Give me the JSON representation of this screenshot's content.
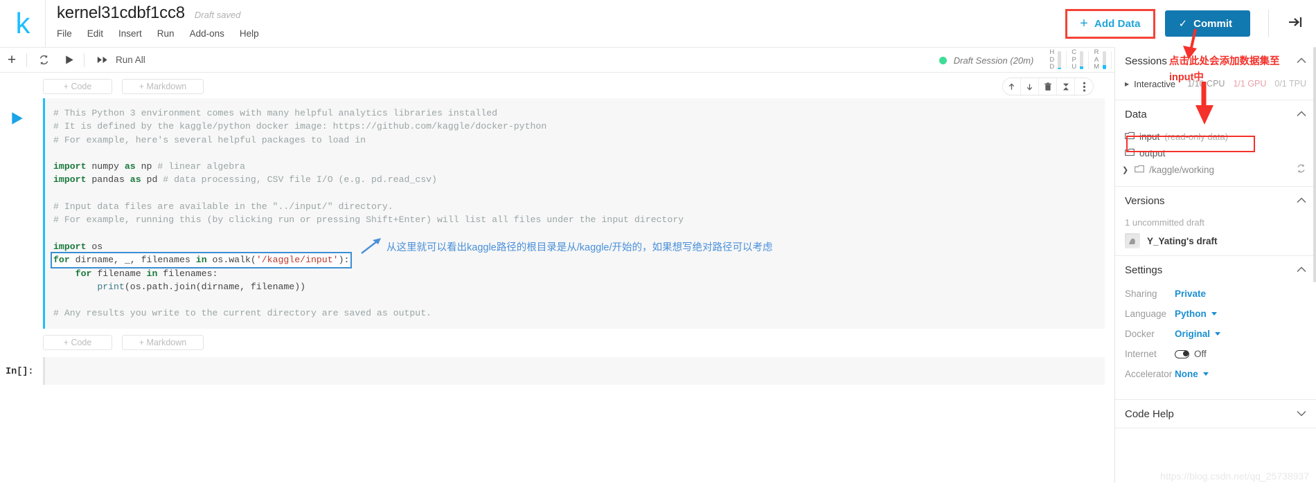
{
  "app": {
    "logo": "k",
    "logo_color": "#20beff",
    "accent_blue": "#20beff",
    "commit_blue": "#1278b0",
    "annotation_red": "#f4312a",
    "annotation_blue": "#4a90d9"
  },
  "header": {
    "kernel_title": "kernel31cdbf1cc8",
    "save_status": "Draft saved",
    "menu": [
      {
        "label": "File",
        "name": "menu-file"
      },
      {
        "label": "Edit",
        "name": "menu-edit"
      },
      {
        "label": "Insert",
        "name": "menu-insert"
      },
      {
        "label": "Run",
        "name": "menu-run"
      },
      {
        "label": "Add-ons",
        "name": "menu-addons"
      },
      {
        "label": "Help",
        "name": "menu-help"
      }
    ],
    "add_data_label": "Add Data",
    "add_data_plus": "+",
    "commit_label": "Commit",
    "commit_check": "✓",
    "collapse_icon": "collapse-sidebar-icon"
  },
  "toolbar": {
    "add_cell_icon": "+",
    "restart_icon": "restart-icon",
    "run_icon": "run-icon",
    "run_all_label": "Run All",
    "session_status": "Draft Session (20m)",
    "session_dot_color": "#3ddc97",
    "gauges": [
      {
        "label": "HDD",
        "letters": [
          "H",
          "D",
          "D"
        ],
        "fill_pct": 8
      },
      {
        "label": "CPU",
        "letters": [
          "C",
          "P",
          "U"
        ],
        "fill_pct": 15
      },
      {
        "label": "RAM",
        "letters": [
          "R",
          "A",
          "M"
        ],
        "fill_pct": 22
      }
    ]
  },
  "cells": {
    "add_code_label": "+ Code",
    "add_markdown_label": "+ Markdown",
    "cell_icons": [
      {
        "name": "move-cell-up-icon",
        "glyph": "↑"
      },
      {
        "name": "move-cell-down-icon",
        "glyph": "↓"
      },
      {
        "name": "delete-cell-icon",
        "glyph": "trash"
      },
      {
        "name": "collapse-cell-icon",
        "glyph": "collapse"
      },
      {
        "name": "cell-more-options-icon",
        "glyph": "⋮"
      }
    ],
    "code_lines": [
      {
        "type": "comment",
        "text": "# This Python 3 environment comes with many helpful analytics libraries installed"
      },
      {
        "type": "comment",
        "text": "# It is defined by the kaggle/python docker image: https://github.com/kaggle/docker-python"
      },
      {
        "type": "comment",
        "text": "# For example, here's several helpful packages to load in"
      },
      {
        "type": "blank",
        "text": ""
      },
      {
        "type": "code",
        "text": "import numpy as np # linear algebra"
      },
      {
        "type": "code",
        "text": "import pandas as pd # data processing, CSV file I/O (e.g. pd.read_csv)"
      },
      {
        "type": "blank",
        "text": ""
      },
      {
        "type": "comment",
        "text": "# Input data files are available in the \"../input/\" directory."
      },
      {
        "type": "comment",
        "text": "# For example, running this (by clicking run or pressing Shift+Enter) will list all files under the input directory"
      },
      {
        "type": "blank",
        "text": ""
      },
      {
        "type": "code",
        "text": "import os"
      },
      {
        "type": "code",
        "highlighted": true,
        "text": "for dirname, _, filenames in os.walk('/kaggle/input'):"
      },
      {
        "type": "code",
        "text": "    for filename in filenames:"
      },
      {
        "type": "code",
        "text": "        print(os.path.join(dirname, filename))"
      },
      {
        "type": "blank",
        "text": ""
      },
      {
        "type": "comment",
        "text": "# Any results you write to the current directory are saved as output."
      }
    ],
    "second_cell_prompt": "In[]:"
  },
  "annotations": {
    "blue_note": "从这里就可以看出kaggle路径的根目录是从/kaggle/开始的，如果想写绝对路径可以考虑",
    "red_note_line1": "点击此处会添加数据集至",
    "red_note_line2": "input中"
  },
  "sidebar": {
    "sessions": {
      "title": "Sessions",
      "chevron": "^",
      "session_name": "Interactive",
      "resources": [
        {
          "label": "1/10 CPU",
          "name": "cpu-usage"
        },
        {
          "label": "1/1 GPU",
          "name": "gpu-usage"
        },
        {
          "label": "0/1 TPU",
          "name": "tpu-usage"
        }
      ]
    },
    "data": {
      "title": "Data",
      "chevron": "^",
      "items": [
        {
          "name": "input",
          "sub": "(read-only data)",
          "kind": "folder",
          "highlighted": true
        },
        {
          "name": "output",
          "sub": "",
          "kind": "folder"
        },
        {
          "name": "/kaggle/working",
          "sub": "",
          "kind": "folder",
          "expandable": true,
          "refresh": true
        }
      ]
    },
    "versions": {
      "title": "Versions",
      "chevron": "^",
      "count_label": "1 uncommitted draft",
      "draft_name": "Y_Yating's draft"
    },
    "settings": {
      "title": "Settings",
      "chevron": "^",
      "rows": [
        {
          "label": "Sharing",
          "value": "Private",
          "control": "link"
        },
        {
          "label": "Language",
          "value": "Python",
          "control": "select"
        },
        {
          "label": "Docker",
          "value": "Original",
          "control": "select"
        },
        {
          "label": "Internet",
          "value": "Off",
          "control": "toggle"
        },
        {
          "label": "Accelerator",
          "value": "None",
          "control": "select"
        }
      ]
    },
    "code_help": {
      "title": "Code Help",
      "chevron": "v"
    }
  },
  "watermark": "https://blog.csdn.net/qq_25738937"
}
